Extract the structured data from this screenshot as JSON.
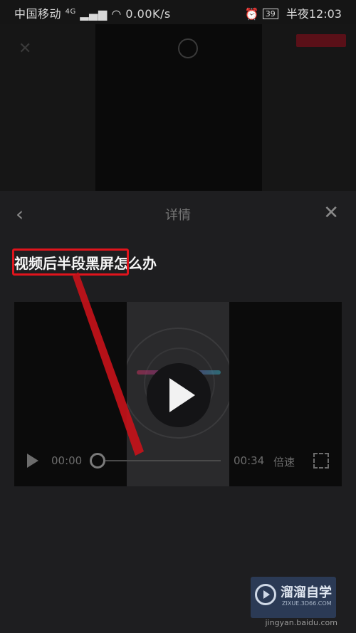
{
  "status_bar": {
    "carrier": "中国移动",
    "network": "4G",
    "speed": "0.00K/s",
    "battery": "39",
    "time": "半夜12:03"
  },
  "panel": {
    "header_title": "详情",
    "question_highlight": "视频后半段黑屏",
    "question_rest": "怎么办"
  },
  "video": {
    "time_start": "00:00",
    "time_end": "00:34",
    "speed_label": "倍速"
  },
  "watermark": {
    "brand_cn": "溜溜自学",
    "brand_en": "ZIXUE.3D66.COM",
    "url": "jingyan.baidu.com"
  },
  "colors": {
    "annotation": "#e0141c",
    "panel_bg": "#1e1e20"
  }
}
